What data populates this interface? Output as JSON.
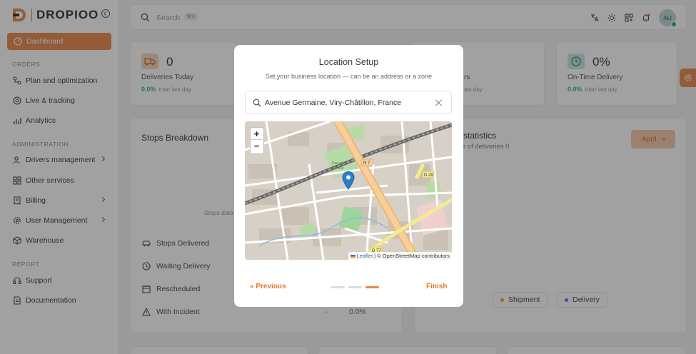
{
  "brand": {
    "name": "DROPIOO"
  },
  "sidebar": {
    "active": "Dashboard",
    "sections": [
      {
        "title": "ORDERS",
        "items": [
          "Plan and optimization",
          "Live & tracking",
          "Analytics"
        ]
      },
      {
        "title": "ADMINISTRATION",
        "items": [
          "Drivers management",
          "Other services",
          "Billing",
          "User Management",
          "Warehouse"
        ]
      },
      {
        "title": "REPORT",
        "items": [
          "Support",
          "Documentation"
        ]
      }
    ]
  },
  "topbar": {
    "search_placeholder": "Search",
    "shortcut": "⌘K",
    "avatar_initials": "AU"
  },
  "stats": [
    {
      "value": "0",
      "label": "Deliveries Today",
      "change": "0.0%",
      "compare": "than last day"
    },
    {
      "label_fragment": "rs",
      "compare_fragment": "ast day"
    },
    {
      "value": "0%",
      "label": "On-Time Delivery",
      "change": "0.0%",
      "compare": "than last day"
    }
  ],
  "stops": {
    "title": "Stops Breakdown",
    "placeholder_fragment": "Stops data",
    "rows": [
      {
        "label": "Stops Delivered"
      },
      {
        "label": "Waiting Delivery"
      },
      {
        "label": "Rescheduled"
      },
      {
        "label": "With Incident",
        "dash": "-",
        "pct": "0.0%"
      }
    ]
  },
  "statistics": {
    "title_fragment": "statistics",
    "subtitle_fragment": "r of deliveries 0",
    "month": "April",
    "legend": [
      {
        "label": "Shipment",
        "color": "#f0a030"
      },
      {
        "label": "Delivery",
        "color": "#8b5cf6"
      }
    ]
  },
  "modal": {
    "title": "Location Setup",
    "subtitle": "Set your business location — can be an address or a zone",
    "search_value": "Avenue Germaine, Viry-Châtillon, France",
    "map": {
      "zoom_in": "+",
      "zoom_out": "−",
      "attribution_leaflet": "Leaflet",
      "attribution_sep": " | © ",
      "attribution_osm": "OpenStreetMap contributors",
      "labels": [
        "N 7",
        "D 29",
        "D 77",
        "Parc du pré aux"
      ]
    },
    "prev_label": "« Previous",
    "finish_label": "Finish",
    "steps": 3,
    "current_step": 3
  },
  "colors": {
    "accent": "#e8874a",
    "positive": "#2bb673",
    "marker": "#2a81cb"
  }
}
